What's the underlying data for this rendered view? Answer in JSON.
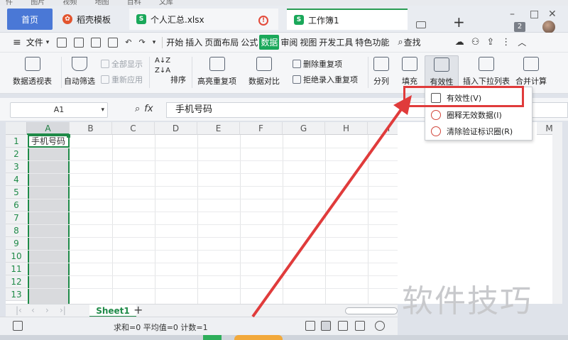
{
  "background_menu": [
    "件",
    "图片",
    "视频",
    "地图",
    "百科",
    "文库"
  ],
  "tabs": [
    {
      "label": "首页"
    },
    {
      "label": "稻壳模板"
    },
    {
      "label": "个人汇总.xlsx"
    },
    {
      "label": "工作簿1"
    }
  ],
  "tab_icon_letter": "S",
  "notification_count": "2",
  "menu": {
    "file": "文件",
    "items": [
      "开始",
      "插入",
      "页面布局",
      "公式",
      "数据",
      "审阅",
      "视图",
      "开发工具",
      "特色功能"
    ],
    "active": "数据",
    "search": "查找"
  },
  "ribbon": {
    "pivot": "数据透视表",
    "autofilter": "自动筛选",
    "show_all": "全部显示",
    "reapply": "重新应用",
    "sort": "排序",
    "highlight_dup": "高亮重复项",
    "delete_dup": "删除重复项",
    "compare": "数据对比",
    "reject_dup": "拒绝录入重复项",
    "split": "分列",
    "fill": "填充",
    "validity": "有效性",
    "insert_dropdown": "插入下拉列表",
    "merge_calc": "合并计算"
  },
  "formula_bar": {
    "cell_ref": "A1",
    "fx": "fx",
    "value": "手机号码"
  },
  "grid": {
    "columns": [
      "A",
      "B",
      "C",
      "D",
      "E",
      "F",
      "G",
      "H",
      "I"
    ],
    "rows": [
      "1",
      "2",
      "3",
      "4",
      "5",
      "6",
      "7",
      "8",
      "9",
      "10",
      "11",
      "12",
      "13"
    ],
    "a1": "手机号码",
    "right_columns": [
      "M"
    ]
  },
  "sheets": {
    "active": "Sheet1",
    "add": "+"
  },
  "status": {
    "stats": "求和=0  平均值=0  计数=1"
  },
  "dropdown": {
    "items": [
      {
        "label": "有效性(V)"
      },
      {
        "label": "圈释无效数据(I)"
      },
      {
        "label": "清除验证标识圈(R)"
      }
    ]
  },
  "watermark": "软件技巧",
  "colors": {
    "accent_green": "#1aa85a",
    "home_tab": "#4a78d6",
    "annotation_red": "#e03b3b"
  }
}
